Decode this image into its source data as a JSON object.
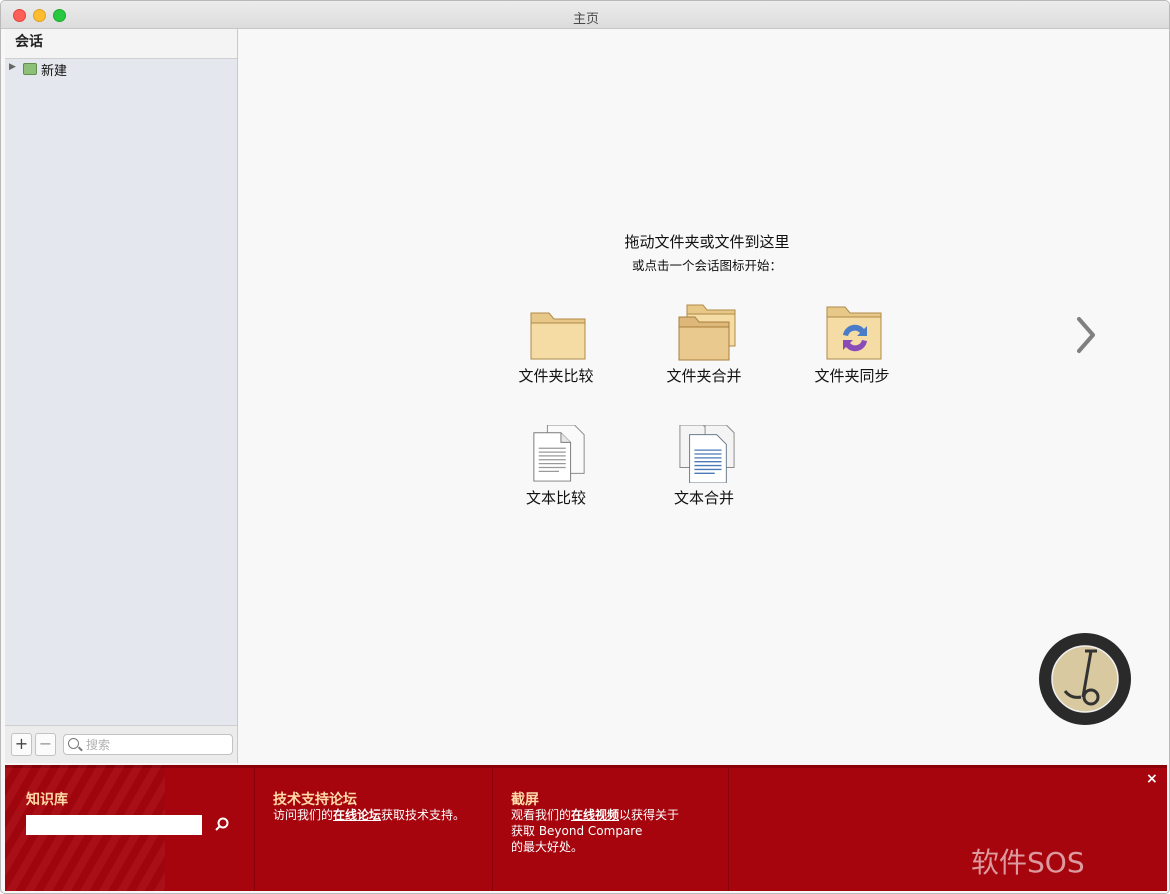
{
  "window": {
    "title": "主页"
  },
  "sidebar": {
    "header": "会话",
    "tree": [
      {
        "label": "新建"
      }
    ],
    "footer": {
      "add_label": "+",
      "remove_label": "−",
      "search_placeholder": "搜索"
    }
  },
  "main": {
    "drop_title": "拖动文件夹或文件到这里",
    "drop_subtitle": "或点击一个会话图标开始：",
    "sessions": [
      {
        "label": "文件夹比较",
        "icon": "folder-compare-icon"
      },
      {
        "label": "文件夹合并",
        "icon": "folder-merge-icon"
      },
      {
        "label": "文件夹同步",
        "icon": "folder-sync-icon"
      },
      {
        "label": "文本比较",
        "icon": "text-compare-icon"
      },
      {
        "label": "文本合并",
        "icon": "text-merge-icon"
      }
    ]
  },
  "bottom": {
    "knowledge_base": {
      "heading": "知识库"
    },
    "forum": {
      "heading": "技术支持论坛",
      "text_before": "访问我们的",
      "link": "在线论坛",
      "text_after": "获取技术支持。"
    },
    "screencast": {
      "heading": "截屏",
      "text_before": "观看我们的",
      "link": "在线视频",
      "text_after": "以获得关于",
      "line2": "获取 Beyond Compare",
      "line3": "的最大好处。"
    },
    "close_label": "×",
    "watermark": "软件SOS"
  },
  "colors": {
    "bottom_bar": "#a6050d",
    "heading": "#ffd9a8",
    "sidebar_bg": "#e4e7ed"
  }
}
